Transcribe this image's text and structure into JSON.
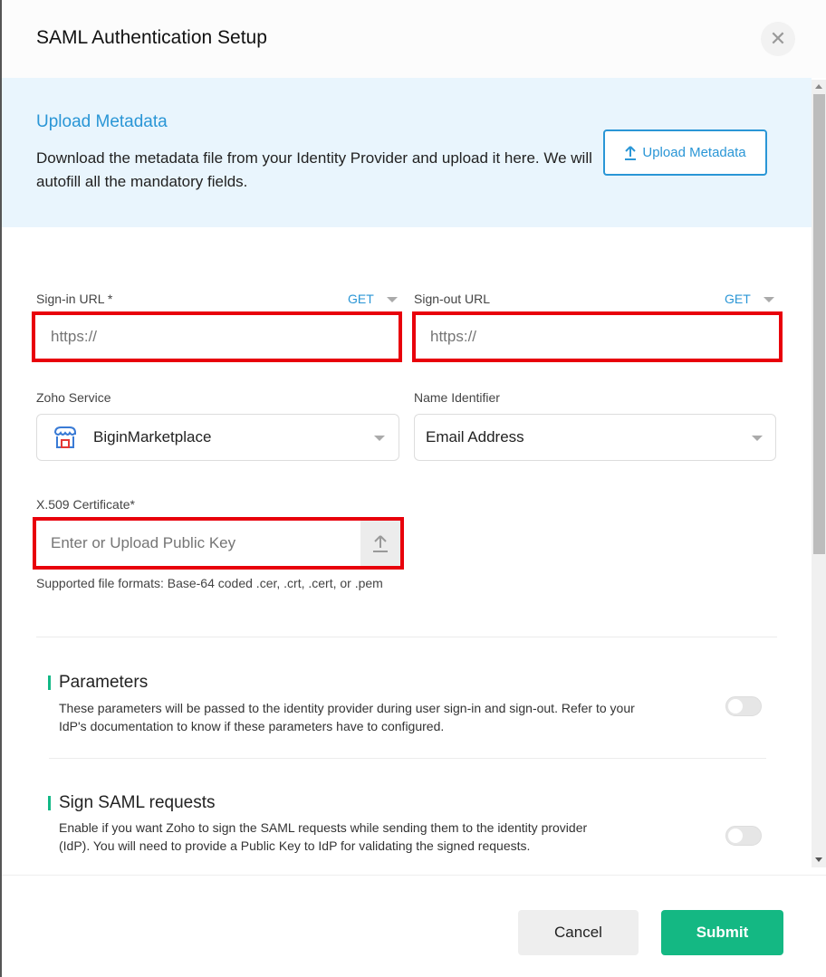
{
  "modal": {
    "title": "SAML Authentication Setup",
    "close_icon": "close-icon"
  },
  "banner": {
    "title": "Upload Metadata",
    "text": "Download the metadata file from your Identity Provider and upload it here. We will autofill all the mandatory fields.",
    "button_label": "Upload Metadata",
    "button_icon": "upload-icon"
  },
  "fields": {
    "signin_url": {
      "label": "Sign-in URL *",
      "method": "GET",
      "placeholder": "https://",
      "value": ""
    },
    "signout_url": {
      "label": "Sign-out URL",
      "method": "GET",
      "placeholder": "https://",
      "value": ""
    },
    "zoho_service": {
      "label": "Zoho Service",
      "value": "BiginMarketplace",
      "icon": "marketplace-store-icon"
    },
    "name_identifier": {
      "label": "Name Identifier",
      "value": "Email Address"
    },
    "certificate": {
      "label": "X.509 Certificate*",
      "placeholder": "Enter or Upload Public Key",
      "hint": "Supported file formats: Base-64 coded .cer, .crt, .cert, or .pem"
    }
  },
  "sections": [
    {
      "title": "Parameters",
      "description": "These parameters will be passed to the identity provider during user sign-in and sign-out. Refer to your IdP's documentation to know if these parameters have to configured.",
      "enabled": false
    },
    {
      "title": "Sign SAML requests",
      "description": "Enable if you want Zoho to sign the SAML requests while sending them to the identity provider (IdP). You will need to provide a Public Key to IdP for validating the signed requests.",
      "enabled": false
    }
  ],
  "footer": {
    "cancel_label": "Cancel",
    "submit_label": "Submit"
  },
  "colors": {
    "accent_blue": "#2a96d6",
    "accent_green": "#14b883",
    "highlight_red": "#e8000b",
    "banner_bg": "#e9f5fd"
  }
}
